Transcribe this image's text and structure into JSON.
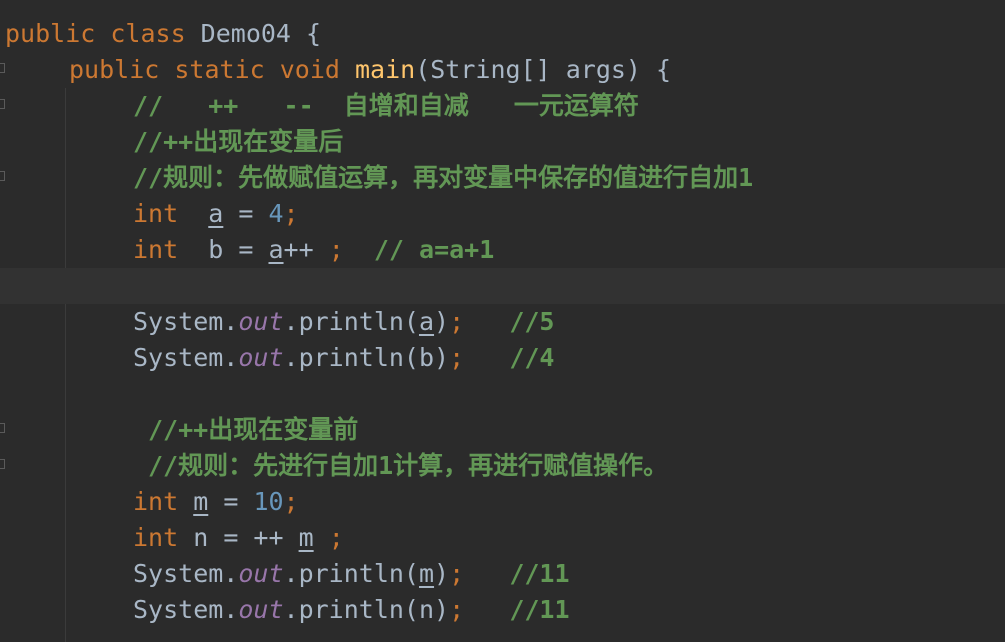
{
  "editor": {
    "lines": [
      {
        "tokens": [
          [
            "kw",
            "public class "
          ],
          [
            "pl",
            "Demo04 {"
          ]
        ]
      },
      {
        "tokens": [
          [
            "kw",
            "public static void "
          ],
          [
            "fn",
            "main"
          ],
          [
            "pl",
            "(String[] args) {"
          ]
        ]
      },
      {
        "tokens": [
          [
            "cm",
            "//   ++   --  自增和自减   一元运算符"
          ]
        ]
      },
      {
        "tokens": [
          [
            "cm",
            "//++出现在变量后"
          ]
        ]
      },
      {
        "tokens": [
          [
            "cm",
            "//规则：先做赋值运算，再对变量中保存的值进行自加1"
          ]
        ]
      },
      {
        "tokens": [
          [
            "kw",
            "int  "
          ],
          [
            "plu",
            "a"
          ],
          [
            "pl",
            " = "
          ],
          [
            "num",
            "4"
          ],
          [
            "kw",
            ";"
          ]
        ]
      },
      {
        "tokens": [
          [
            "kw",
            "int  "
          ],
          [
            "pl",
            "b = "
          ],
          [
            "plu",
            "a"
          ],
          [
            "pl",
            "++ "
          ],
          [
            "kw",
            ";"
          ],
          [
            "pl",
            "  "
          ],
          [
            "cm",
            "// a=a+1"
          ]
        ]
      },
      {
        "tokens": []
      },
      {
        "tokens": [
          [
            "pl",
            "System."
          ],
          [
            "st",
            "out"
          ],
          [
            "pl",
            ".println("
          ],
          [
            "plu",
            "a"
          ],
          [
            "pl",
            ")"
          ],
          [
            "kw",
            ";"
          ],
          [
            "pl",
            "   "
          ],
          [
            "cm",
            "//5"
          ]
        ]
      },
      {
        "tokens": [
          [
            "pl",
            "System."
          ],
          [
            "st",
            "out"
          ],
          [
            "pl",
            ".println(b)"
          ],
          [
            "kw",
            ";"
          ],
          [
            "pl",
            "   "
          ],
          [
            "cm",
            "//4"
          ]
        ]
      },
      {
        "tokens": []
      },
      {
        "tokens": [
          [
            "cm",
            "//++出现在变量前"
          ]
        ]
      },
      {
        "tokens": [
          [
            "cm",
            "//规则：先进行自加1计算，再进行赋值操作。"
          ]
        ]
      },
      {
        "tokens": [
          [
            "kw",
            "int "
          ],
          [
            "plu",
            "m"
          ],
          [
            "pl",
            " = "
          ],
          [
            "num",
            "10"
          ],
          [
            "kw",
            ";"
          ]
        ]
      },
      {
        "tokens": [
          [
            "kw",
            "int "
          ],
          [
            "pl",
            "n = ++ "
          ],
          [
            "plu",
            "m"
          ],
          [
            "pl",
            " "
          ],
          [
            "kw",
            ";"
          ]
        ]
      },
      {
        "tokens": [
          [
            "pl",
            "System."
          ],
          [
            "st",
            "out"
          ],
          [
            "pl",
            ".println("
          ],
          [
            "plu",
            "m"
          ],
          [
            "pl",
            ")"
          ],
          [
            "kw",
            ";"
          ],
          [
            "pl",
            "   "
          ],
          [
            "cm",
            "//11"
          ]
        ]
      },
      {
        "tokens": [
          [
            "pl",
            "System."
          ],
          [
            "st",
            "out"
          ],
          [
            "pl",
            ".println(n)"
          ],
          [
            "kw",
            ";"
          ],
          [
            "pl",
            "   "
          ],
          [
            "cm",
            "//11"
          ]
        ]
      }
    ]
  },
  "colors": {
    "background": "#2b2b2b",
    "caret_line": "#323232",
    "keyword": "#cc7832",
    "plain": "#a9b7c6",
    "method": "#ffc66d",
    "number": "#6897bb",
    "static_field": "#9876aa",
    "comment": "#629755"
  }
}
